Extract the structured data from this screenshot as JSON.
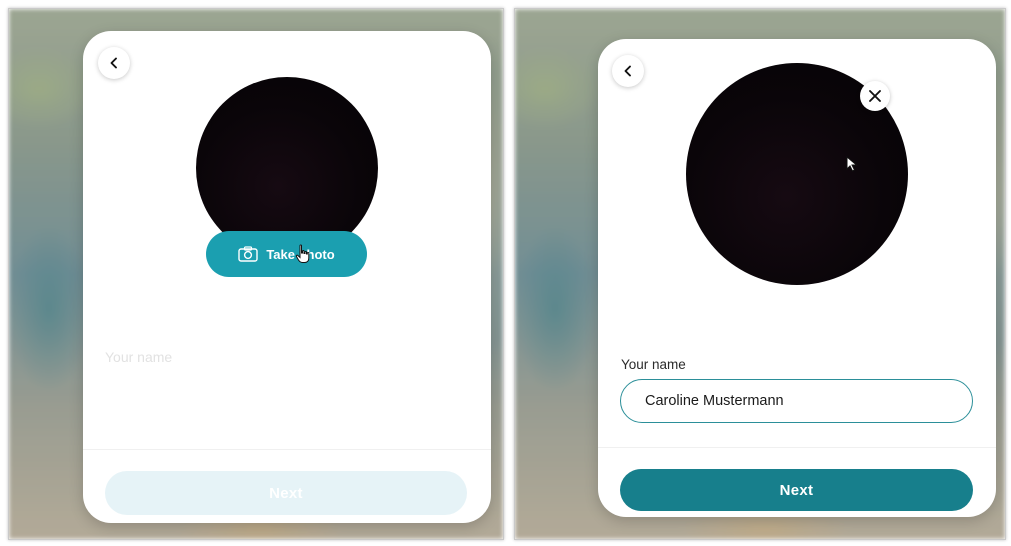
{
  "left_screen": {
    "take_photo_label": "Take photo",
    "name_placeholder": "Your name",
    "next_label": "Next"
  },
  "right_screen": {
    "name_label": "Your name",
    "name_value": "Caroline Mustermann",
    "next_label": "Next"
  },
  "icons": {
    "back": "chevron-left-icon",
    "camera": "camera-icon",
    "clear": "close-icon"
  },
  "colors": {
    "accent": "#1b9fb0",
    "next_enabled": "#177f8c",
    "next_disabled": "#e6f3f7",
    "input_border": "#2b8f99"
  }
}
